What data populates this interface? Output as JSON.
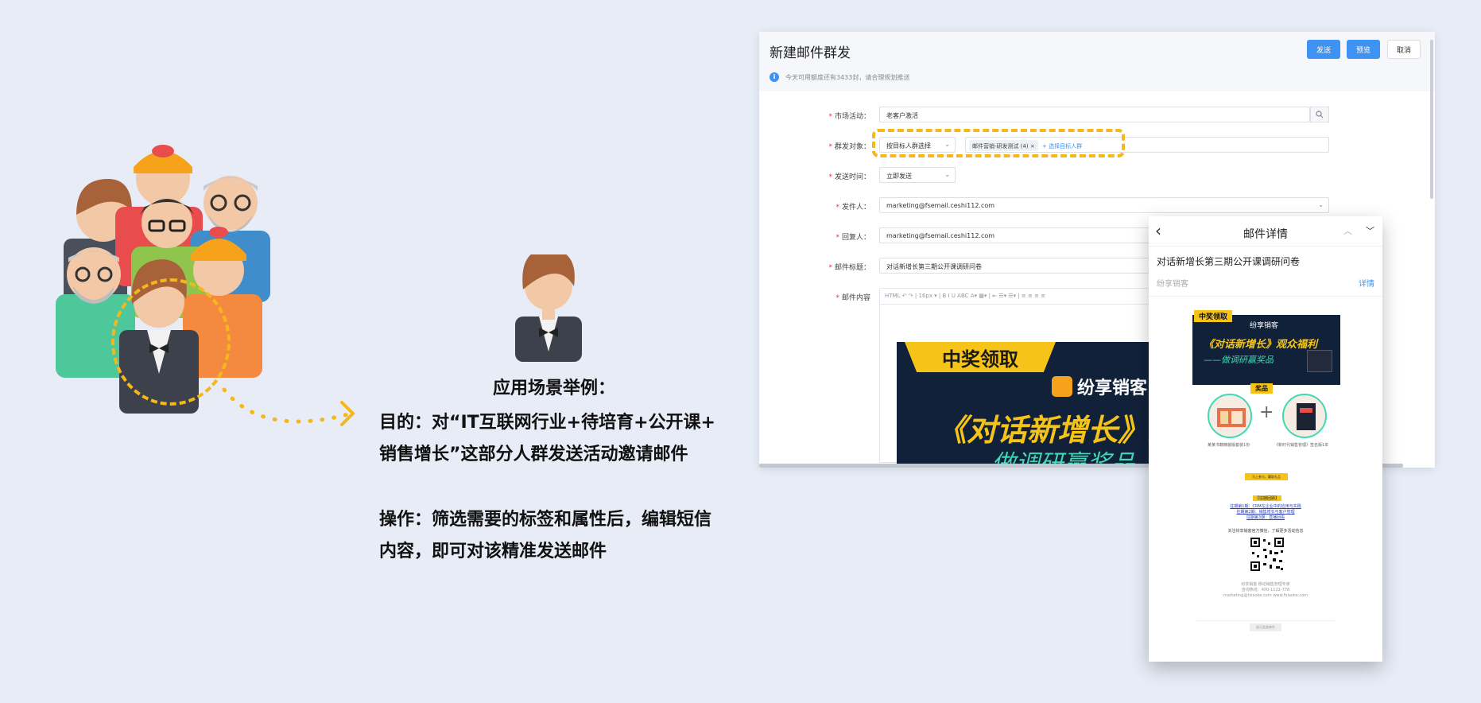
{
  "scenario": {
    "title": "应用场景举例：",
    "goal_line1": "目的：对“IT互联网行业+待培育+公开课+",
    "goal_line2": "销售增长”这部分人群发送活动邀请邮件",
    "op_line1": "操作：筛选需要的标签和属性后，编辑短信",
    "op_line2": "内容，即可对该精准发送邮件"
  },
  "mail_form": {
    "title": "新建邮件群发",
    "buttons": {
      "send": "发送",
      "preview": "预览",
      "cancel": "取消"
    },
    "notice": "今天可用额度还有3433封，请合理规划推送",
    "fields": {
      "campaign_label": "市场活动：",
      "campaign_value": "老客户激活",
      "target_label": "群发对象：",
      "target_mode": "按目标人群选择",
      "target_tag": "邮件营销-研发测试 (4)",
      "target_add": "+ 选择目标人群",
      "time_label": "发送时间：",
      "time_value": "立即发送",
      "sender_label": "发件人：",
      "sender_value": "marketing@fsemail.ceshi112.com",
      "reply_label": "回复人：",
      "reply_value": "marketing@fsemail.ceshi112.com",
      "subject_label": "邮件标题：",
      "subject_value": "对话新增长第三期公开课调研问卷",
      "content_label": "邮件内容"
    },
    "toolbar": "HTML ↶ ↷ | 16px ▾ | B I U ABC A▾ ▦▾ | ⇤ ☰▾ ☰▾ | ≡ ≡ ≡ ≡",
    "banner": {
      "tag": "中奖领取",
      "brand": "纷享销客",
      "title": "《对话新增长》观",
      "subtitle": "—— 做调研赢奖品"
    }
  },
  "preview": {
    "header_title": "邮件详情",
    "subject": "对话新增长第三期公开课调研问卷",
    "sender": "纷享销客",
    "detail_link": "详情",
    "banner_tag": "中奖领取",
    "banner_brand": "纷享销客",
    "banner_title": "《对话新增长》观众福利",
    "banner_sub": "——做调研赢奖品",
    "prize_label": "奖品",
    "item1_caption": "某某书籍精装版套装1份",
    "item2_caption": "《新时代销售管理》签名版1本",
    "cta": "马上参与，赢取礼品",
    "tagline": "【往期回顾】",
    "links": [
      "往期第1期：CRM在企业中的应用与实践",
      "往期第2期：销售增长与客户管理",
      "往期第3期：直播回看"
    ],
    "follow": "关注纷享销客官方微信，了解更多活动信息",
    "footer": [
      "纷享销客 移动销售管理专家",
      "咨询热线：400-1122-778",
      "marketing@fxiaoke.com  www.fxiaoke.com"
    ],
    "unsubscribe": "退订此类邮件"
  },
  "colors": {
    "accent": "#3e93f2",
    "highlight": "#f6b71b",
    "banner_bg": "#12213a",
    "banner_gold": "#f6c419",
    "banner_teal": "#3fd9b3"
  }
}
